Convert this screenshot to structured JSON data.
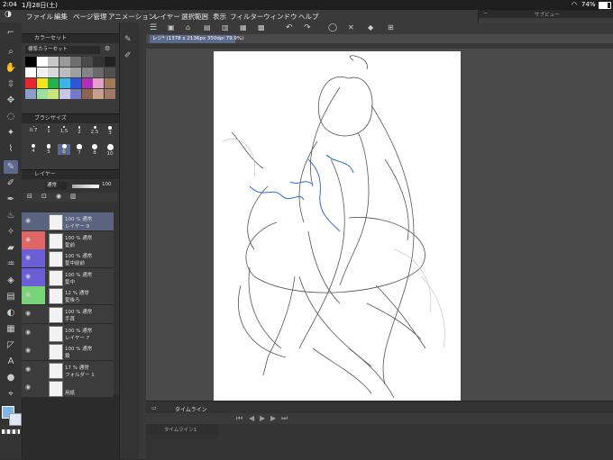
{
  "status": {
    "time": "2:04",
    "date": "1月28日(土)",
    "battery": "74%"
  },
  "menu": [
    "ファイル",
    "編集",
    "ページ管理",
    "アニメーション",
    "レイヤー",
    "選択範囲",
    "表示",
    "フィルター",
    "ウィンドウ",
    "ヘルプ"
  ],
  "subview": {
    "title": "サブビュー"
  },
  "document": {
    "tab_label": "レジ* (1378 x 2136px 350dpi 79.9%)"
  },
  "color_panel": {
    "title": "カラーセット",
    "set_name": "標準カラーセット"
  },
  "swatches": [
    "#000000",
    "#ffffff",
    "#c8c8c8",
    "#9a9a9a",
    "#6e6e6e",
    "#4a4a4a",
    "#333333",
    "#222222",
    "#ffffff",
    "#f2f2f2",
    "#d8d8d8",
    "#bdbdbd",
    "#a0a0a0",
    "#848484",
    "#6a6a6a",
    "#505050",
    "#e8262c",
    "#f5e41a",
    "#23b14d",
    "#3cb4e6",
    "#2a58d6",
    "#b12fb8",
    "#e6a0c8",
    "#a0785a",
    "#8aa0c8",
    "#9ae0a0",
    "#c8e678",
    "#c8c8e6",
    "#7878c8",
    "#8c6450",
    "#c8a08c",
    "#a07866"
  ],
  "brush_panel": {
    "title": "ブラシサイズ",
    "sizes": [
      "0.7",
      "1",
      "1.5",
      "2",
      "2.5",
      "3",
      "4",
      "5",
      "6",
      "7",
      "8",
      "10"
    ]
  },
  "layer_panel": {
    "title": "レイヤー",
    "blend": "通常",
    "opacity": "100"
  },
  "layers": [
    {
      "l1": "100 % 通常",
      "l2": "レイヤー 9",
      "color": "",
      "selected": true
    },
    {
      "l1": "100 % 通常",
      "l2": "髪前",
      "color": "#e06565",
      "selected": false
    },
    {
      "l1": "100 % 通常",
      "l2": "髪中前前",
      "color": "#6a5fd6",
      "selected": false
    },
    {
      "l1": "100 % 通常",
      "l2": "髪中",
      "color": "#6a5fd6",
      "selected": false
    },
    {
      "l1": "12 % 通常",
      "l2": "髪後ろ",
      "color": "#79d479",
      "selected": false
    },
    {
      "l1": "100 % 通常",
      "l2": "手首",
      "color": "",
      "selected": false
    },
    {
      "l1": "100 % 通常",
      "l2": "レイヤー 7",
      "color": "",
      "selected": false
    },
    {
      "l1": "100 % 通常",
      "l2": "鎖",
      "color": "",
      "selected": false
    },
    {
      "l1": "17 % 通常",
      "l2": "フォルダー 1",
      "color": "",
      "selected": false
    },
    {
      "l1": "",
      "l2": "用紙",
      "color": "",
      "selected": false
    }
  ],
  "timeline": {
    "title": "タイムライン",
    "row_label": "タイムライン1"
  },
  "icons": [
    "pen-icon",
    "move-icon",
    "zoom-icon",
    "hand-icon",
    "select-icon",
    "lasso-icon",
    "eyedropper-icon",
    "brush-icon",
    "eraser-icon",
    "fill-icon",
    "gradient-icon",
    "text-icon",
    "ruler-icon",
    "undo-icon",
    "redo-icon"
  ]
}
